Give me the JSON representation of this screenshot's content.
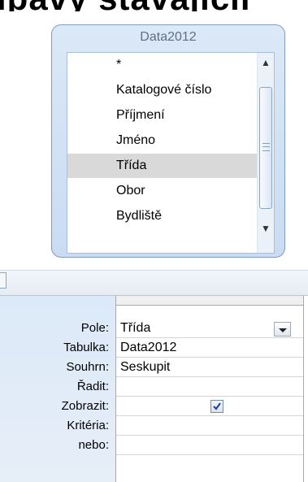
{
  "top_text": "ipavy stavajicir",
  "table": {
    "title": "Data2012",
    "fields": [
      {
        "label": "*",
        "selected": false
      },
      {
        "label": "Katalogové číslo",
        "selected": false
      },
      {
        "label": "Příjmení",
        "selected": false
      },
      {
        "label": "Jméno",
        "selected": false
      },
      {
        "label": "Třída",
        "selected": true
      },
      {
        "label": "Obor",
        "selected": false
      },
      {
        "label": "Bydliště",
        "selected": false
      }
    ],
    "scroll_up_icon": "arrow-up",
    "scroll_down_icon": "arrow-down"
  },
  "grid": {
    "labels": {
      "field": "Pole:",
      "table": "Tabulka:",
      "total": "Souhrn:",
      "sort": "Řadit:",
      "show": "Zobrazit:",
      "criteria": "Kritéria:",
      "or": "nebo:"
    },
    "column": {
      "field": "Třída",
      "table": "Data2012",
      "total": "Seskupit",
      "sort": "",
      "show": true,
      "criteria": "",
      "or": ""
    }
  },
  "colors": {
    "table_border": "#7f9db9",
    "selected_row": "#d9d9d9",
    "grid_label_bg": "#dce9f8"
  }
}
